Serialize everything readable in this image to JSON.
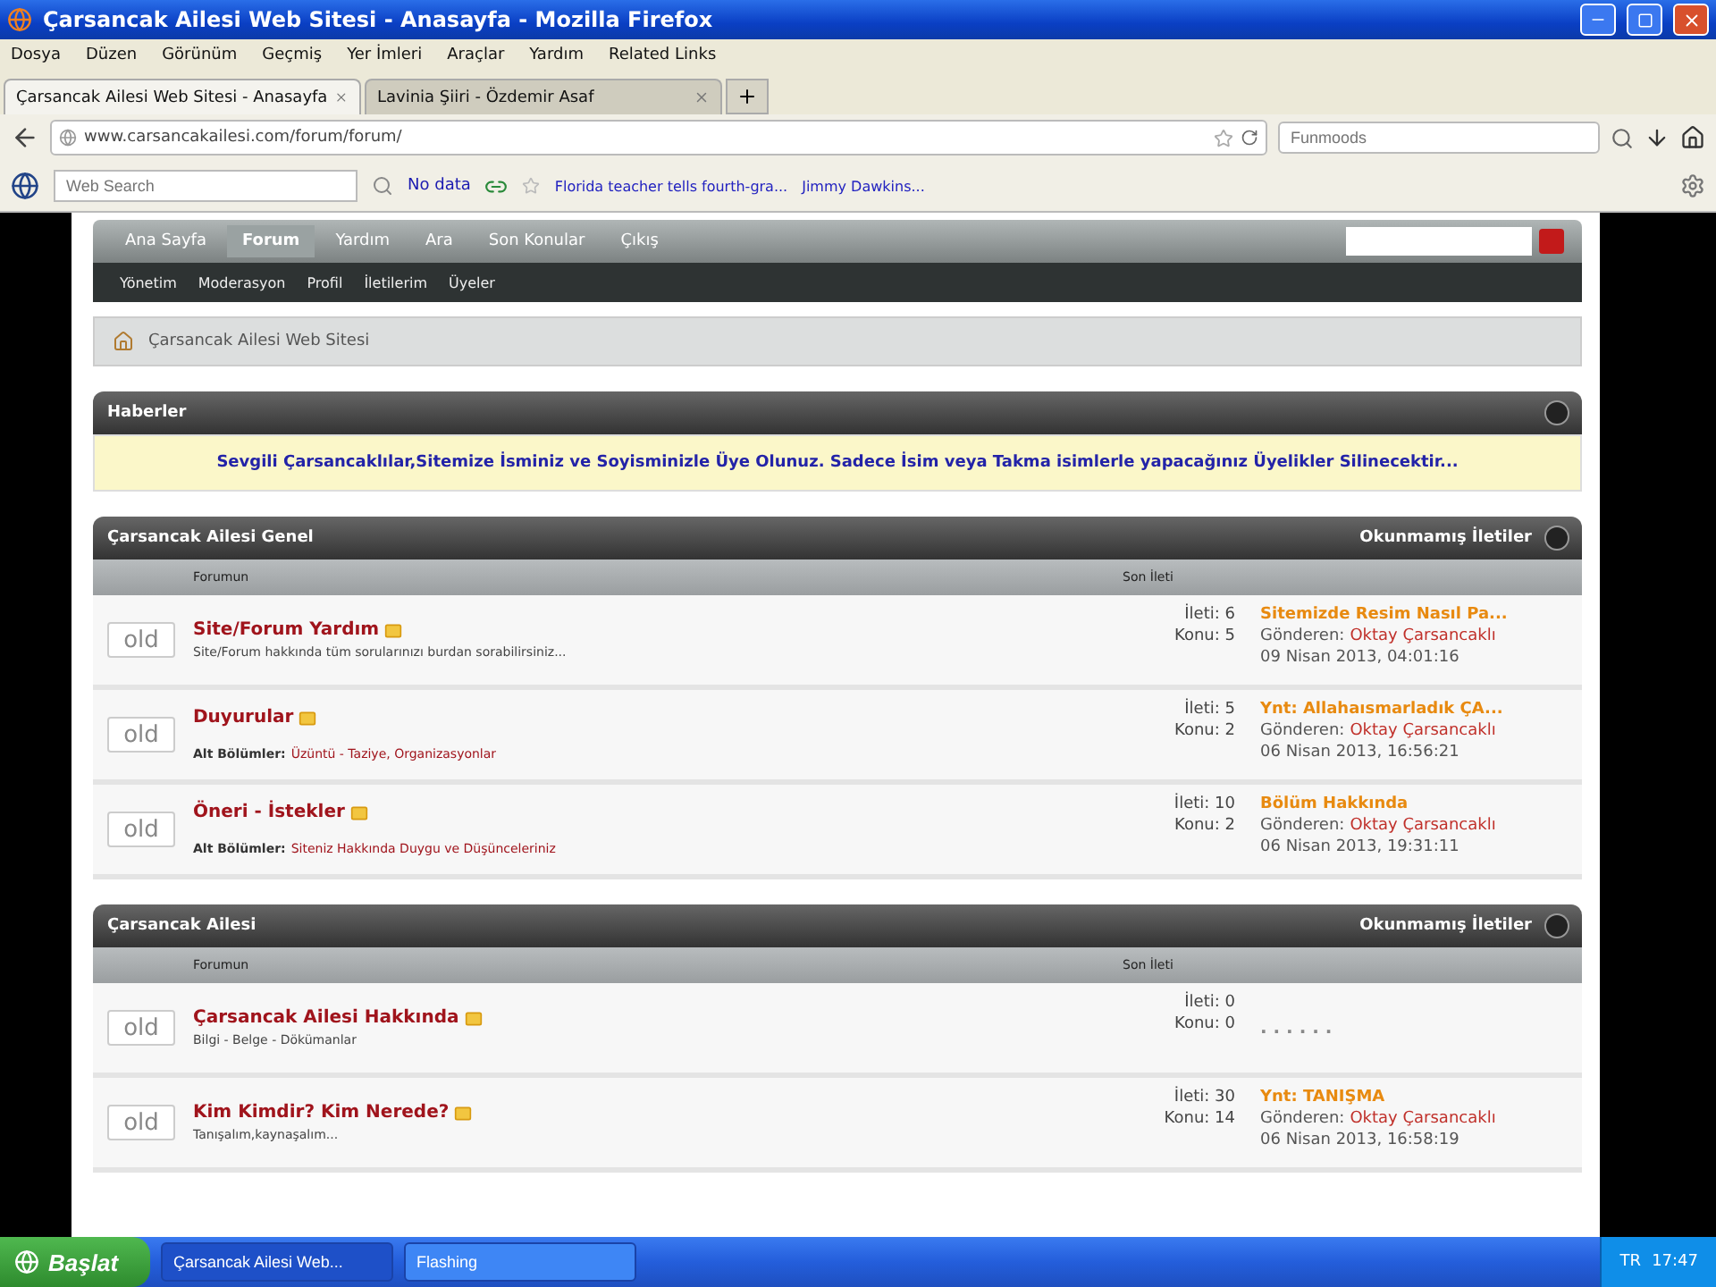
{
  "window": {
    "title": "Çarsancak Ailesi Web Sitesi - Anasayfa - Mozilla Firefox"
  },
  "menu": [
    "Dosya",
    "Düzen",
    "Görünüm",
    "Geçmiş",
    "Yer İmleri",
    "Araçlar",
    "Yardım",
    "Related Links"
  ],
  "tabs": [
    {
      "label": "Çarsancak Ailesi Web Sitesi - Anasayfa",
      "selected": true
    },
    {
      "label": "Lavinia Şiiri - Özdemir Asaf",
      "selected": false
    }
  ],
  "address": {
    "url": "www.carsancakailesi.com/forum/forum/"
  },
  "search": {
    "placeholder": "Funmoods"
  },
  "toolbar": {
    "search_placeholder": "Web Search",
    "status": "No data",
    "links": [
      "Florida teacher tells fourth-gra...",
      "Jimmy Dawkins..."
    ]
  },
  "site": {
    "nav": [
      {
        "label": "Ana Sayfa",
        "selected": false
      },
      {
        "label": "Forum",
        "selected": true
      },
      {
        "label": "Yardım",
        "selected": false
      },
      {
        "label": "Ara",
        "selected": false
      },
      {
        "label": "Son Konular",
        "selected": false
      },
      {
        "label": "Çıkış",
        "selected": false
      }
    ],
    "subnav": [
      "Yönetim",
      "Moderasyon",
      "Profil",
      "İletilerim",
      "Üyeler"
    ],
    "breadcrumb": "Çarsancak Ailesi Web Sitesi",
    "news": {
      "title": "Haberler",
      "message": "Sevgili Çarsancaklılar,Sitemize İsminiz ve Soyisminizle Üye Olunuz. Sadece İsim veya Takma isimlerle yapacağınız Üyelikler Silinecektir..."
    },
    "sections": [
      {
        "title": "Çarsancak Ailesi Genel",
        "unread": "Okunmamış İletiler",
        "col_forum": "Forumun",
        "col_last": "Son İleti",
        "forums": [
          {
            "icon_text": "old",
            "title": "Site/Forum Yardım",
            "description": "Site/Forum hakkında tüm sorularınızı burdan sorabilirsiniz...",
            "posts": "İleti: 6",
            "topics": "Konu: 5",
            "last": {
              "title": "Sitemizde Resim Nasıl Pa...",
              "by_label": "Gönderen:",
              "by": "Oktay Çarsancaklı",
              "date": "09 Nisan 2013, 04:01:16"
            }
          },
          {
            "icon_text": "old",
            "title": "Duyurular",
            "subforums_label": "Alt Bölümler:",
            "subforums": "Üzüntü - Taziye, Organizasyonlar",
            "posts": "İleti: 5",
            "topics": "Konu: 2",
            "last": {
              "title": "Ynt: Allahaısmarladık ÇA...",
              "by_label": "Gönderen:",
              "by": "Oktay Çarsancaklı",
              "date": "06 Nisan 2013, 16:56:21"
            }
          },
          {
            "icon_text": "old",
            "title": "Öneri - İstekler",
            "subforums_label": "Alt Bölümler:",
            "subforums": "Siteniz Hakkında Duygu ve Düşünceleriniz",
            "posts": "İleti: 10",
            "topics": "Konu: 2",
            "last": {
              "title": "Bölüm Hakkında",
              "by_label": "Gönderen:",
              "by": "Oktay Çarsancaklı",
              "date": "06 Nisan 2013, 19:31:11"
            }
          }
        ]
      },
      {
        "title": "Çarsancak Ailesi",
        "unread": "Okunmamış İletiler",
        "col_forum": "Forumun",
        "col_last": "Son İleti",
        "forums": [
          {
            "icon_text": "old",
            "title": "Çarsancak Ailesi Hakkında",
            "description": "Bilgi - Belge - Dökümanlar",
            "posts": "İleti: 0",
            "topics": "Konu: 0",
            "empty": ". . . . . ."
          },
          {
            "icon_text": "old",
            "title": "Kim Kimdir? Kim Nerede?",
            "description": "Tanışalım,kaynaşalım...",
            "posts": "İleti: 30",
            "topics": "Konu: 14",
            "last": {
              "title": "Ynt: TANIŞMA",
              "by_label": "Gönderen:",
              "by": "Oktay Çarsancaklı",
              "date": "06 Nisan 2013, 16:58:19"
            }
          }
        ]
      }
    ]
  },
  "taskbar": {
    "start": "Başlat",
    "tasks": [
      {
        "label": "Çarsancak Ailesi Web...",
        "selected": false
      },
      {
        "label": "Flashing",
        "selected": true
      }
    ],
    "lang": "TR",
    "clock": "17:47"
  }
}
